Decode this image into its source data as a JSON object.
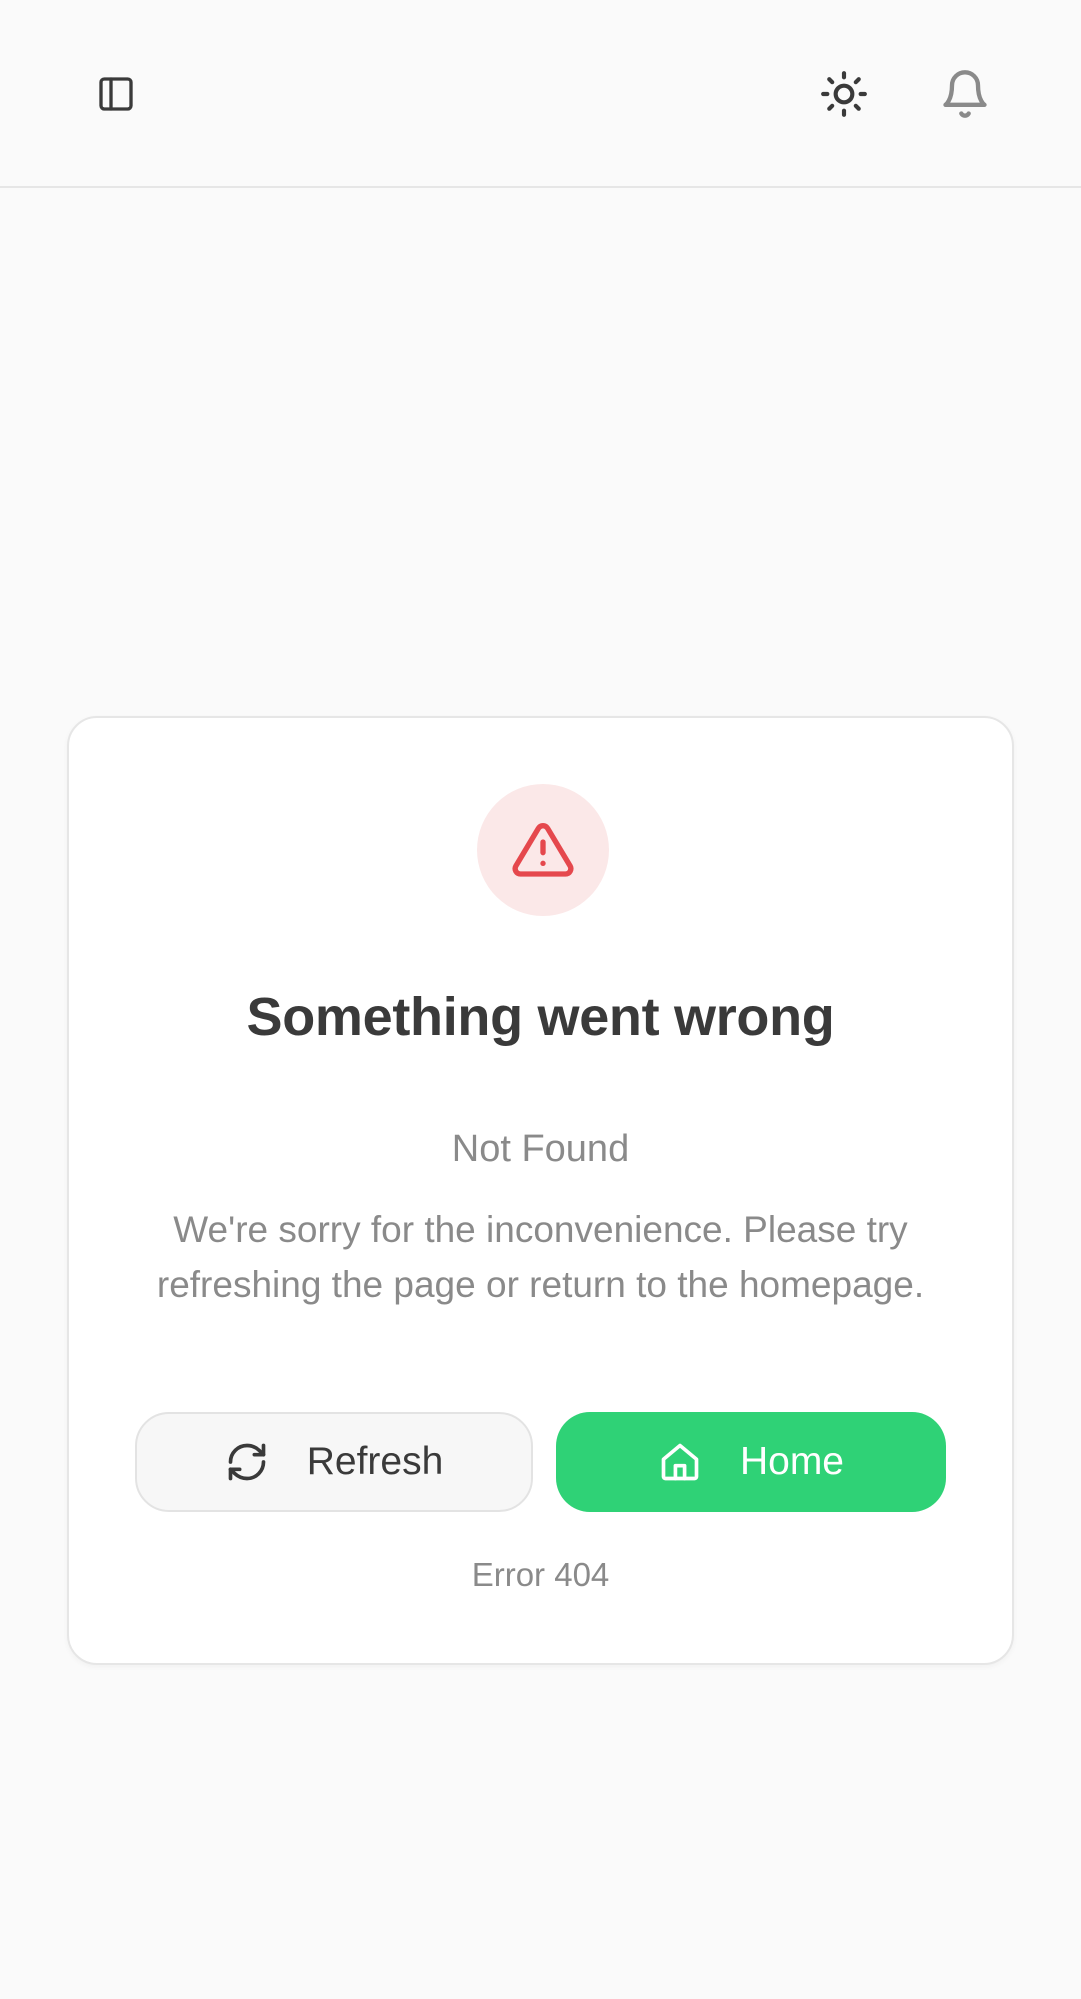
{
  "header": {
    "sidebar_toggle_icon": "sidebar-panel-icon",
    "theme_toggle_icon": "sun-icon",
    "notifications_icon": "bell-icon"
  },
  "error": {
    "icon": "alert-triangle-icon",
    "title": "Something went wrong",
    "status_text": "Not Found",
    "message": "We're sorry for the inconvenience. Please try refreshing the page or return to the homepage.",
    "code_text": "Error 404"
  },
  "actions": {
    "refresh_label": "Refresh",
    "refresh_icon": "refresh-icon",
    "home_label": "Home",
    "home_icon": "home-icon"
  },
  "colors": {
    "accent": "#2fd276",
    "danger": "#e5484d",
    "danger_bg": "#fbe8e8",
    "background": "#fafafa"
  }
}
